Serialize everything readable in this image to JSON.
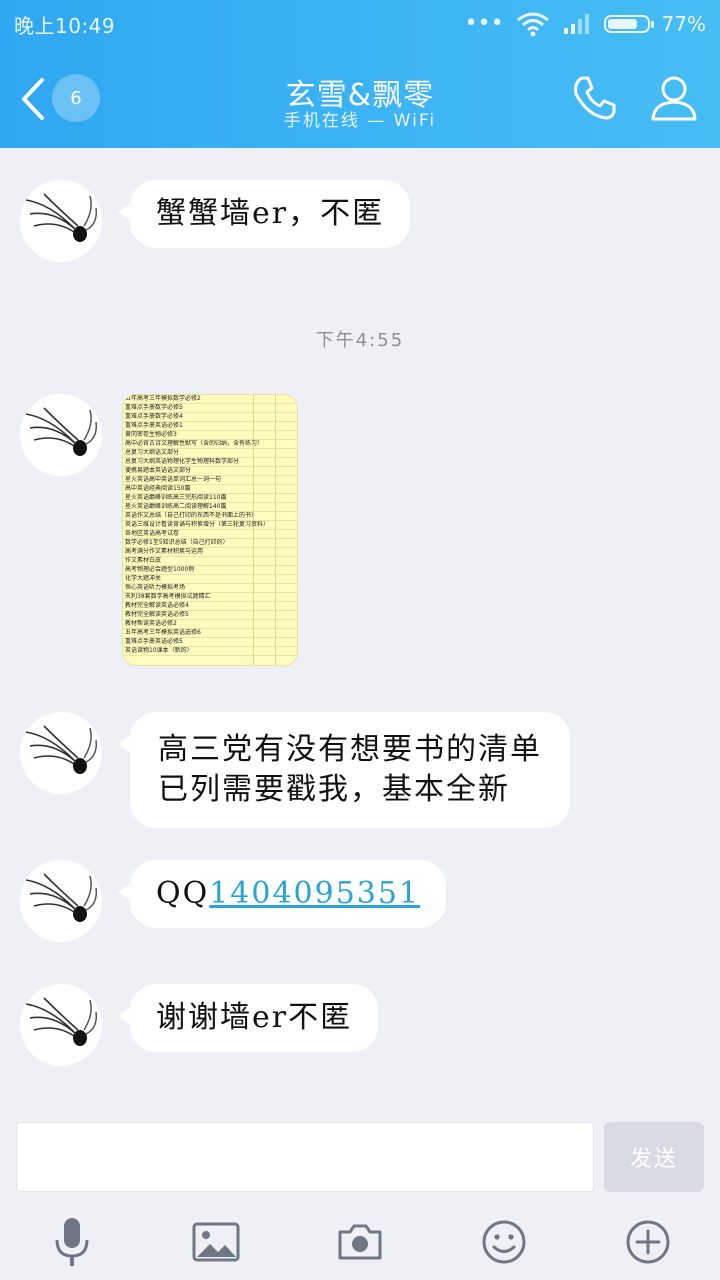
{
  "status_bar": {
    "time": "晚上10:49",
    "battery_percent": 77,
    "battery_label": "77%"
  },
  "header": {
    "unread_count": "6",
    "title": "玄雪&飘零",
    "subtitle": "手机在线 — WiFi"
  },
  "messages": {
    "m1": "蟹蟹墙er，不匿",
    "timestamp": "下午4:55",
    "m3_line1": "高三党有没有想要书的清单",
    "m3_line2": "已列需要戳我，基本全新",
    "m4_prefix": "QQ",
    "m4_number": "1404095351",
    "m5": "谢谢墙er不匿"
  },
  "sheet_rows": [
    "五年高考三年模拟数学必修2",
    "重难点手册数学必修5",
    "重难点手册数学必修4",
    "重难点手册英语必修1",
    "黄冈密卷生物必修3",
    "高中必背古诗文理解性默写（含的归纳，含有练习）",
    "总复习大纲语文部分",
    "总复习大纲英语物理化学生物理科数学部分",
    "便携易题本英语语文部分",
    "星火英语高中英语单词汇总一词一句",
    "高中英语经典阅读150篇",
    "星火英语巅峰训练高三完形阅读110篇",
    "星火英语巅峰训练高二阅读理解140篇",
    "英语作文总结（自己打印的东西不是书面上的书）",
    "英语三维设计看读背诵与积累增分（第三轮复习资料）",
    "各地区英语高考试卷",
    "数学必修1至5知识总结（自己打印的）",
    "高考满分作文素材积累与运用",
    "作文素材白皮",
    "高考物理必会题型1000例",
    "化学大题冲关",
    "恒心英语听力模拟考场",
    "天利38套数学高考模拟试题精汇",
    "教材完全解读英语必修4",
    "教材完全解读英语必修5",
    "教材帮读英语必修2",
    "五年高考三年模拟英语选修6",
    "重难点手册英语必修5",
    "英语读物10课本（新的）"
  ],
  "composer": {
    "send_label": "发送"
  }
}
